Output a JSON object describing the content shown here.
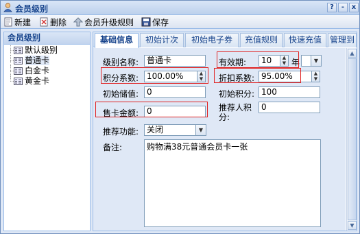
{
  "window": {
    "title": "会员级别",
    "btn_help": "?",
    "btn_min": "-",
    "btn_close": "x"
  },
  "toolbar": {
    "new_label": "新建",
    "delete_label": "删除",
    "upgrade_label": "会员升级规则",
    "save_label": "保存"
  },
  "left_panel": {
    "header": "会员级别",
    "items": [
      {
        "label": "默认级别"
      },
      {
        "label": "普通卡"
      },
      {
        "label": "白金卡"
      },
      {
        "label": "黄金卡"
      }
    ]
  },
  "tabs": [
    {
      "label": "基础信息"
    },
    {
      "label": "初始计次"
    },
    {
      "label": "初始电子券"
    },
    {
      "label": "充值规则"
    },
    {
      "label": "快速充值"
    },
    {
      "label": "管理到"
    }
  ],
  "form": {
    "level_name_label": "级别名称:",
    "level_name_value": "普通卡",
    "validity_label": "有效期:",
    "validity_value": "10",
    "validity_unit": "年",
    "points_ratio_label": "积分系数:",
    "points_ratio_value": "100.00%",
    "discount_label": "折扣系数:",
    "discount_value": "95.00%",
    "init_balance_label": "初始储值:",
    "init_balance_value": "0",
    "init_points_label": "初始积分:",
    "init_points_value": "100",
    "card_price_label": "售卡金额:",
    "card_price_value": "0",
    "referrer_points_label": "推荐人积分:",
    "referrer_points_value": "0",
    "recommend_label": "推荐功能:",
    "recommend_value": "关闭",
    "remark_label": "备注:",
    "remark_value": "购物满38元普通会员卡一张"
  },
  "colors": {
    "highlight_border": "#e02020",
    "accent": "#15428b"
  }
}
